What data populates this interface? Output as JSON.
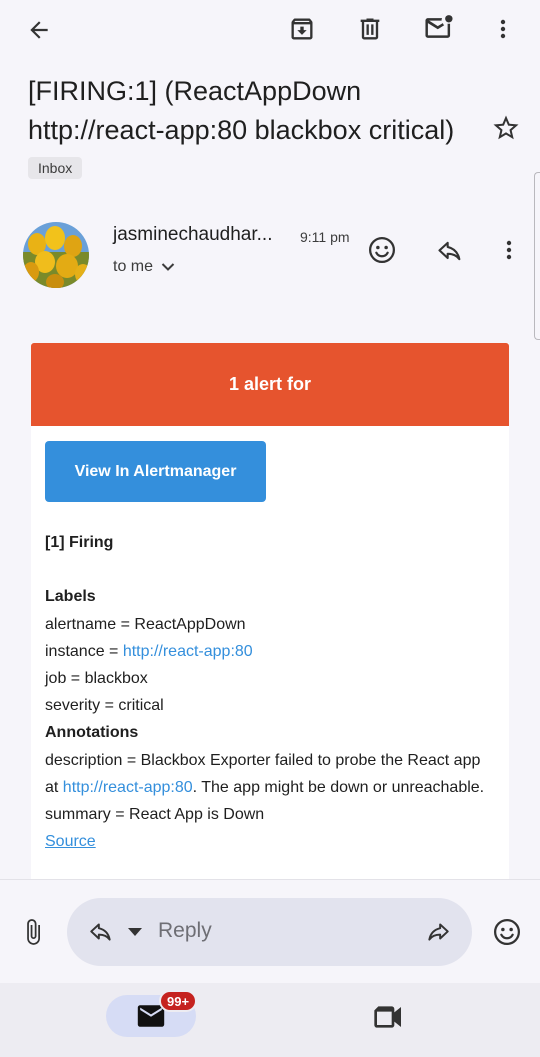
{
  "toolbar": {
    "icons": [
      "back-arrow-icon",
      "archive-icon",
      "delete-icon",
      "mark-unread-icon",
      "more-vert-icon"
    ]
  },
  "email": {
    "subject": "[FIRING:1]  (ReactAppDown http://react-app:80 blackbox critical)",
    "label_chip": "Inbox",
    "sender": "jasminechaudhar...",
    "time": "9:11 pm",
    "recipient": "to me"
  },
  "alert": {
    "header": "1 alert for",
    "button_label": "View In Alertmanager",
    "firing_title": "[1] Firing",
    "labels_heading": "Labels",
    "label_alertname": "alertname = ReactAppDown",
    "label_instance_prefix": "instance = ",
    "label_instance_link": "http://react-app:80",
    "label_job": "job = blackbox",
    "label_severity": "severity = critical",
    "annotations_heading": "Annotations",
    "desc_prefix": "description = Blackbox Exporter failed to probe the React app at ",
    "desc_link": "http://react-app:80",
    "desc_suffix": ". The app might be down or unreachable.",
    "summary": "summary = React App is Down",
    "source_link": "Source"
  },
  "compose": {
    "reply_placeholder": "Reply"
  },
  "bottom_nav": {
    "mail_badge": "99+"
  },
  "colors": {
    "alert_header": "#e6542e",
    "button": "#348fdc",
    "link": "#348fdc",
    "badge": "#c5221f"
  }
}
